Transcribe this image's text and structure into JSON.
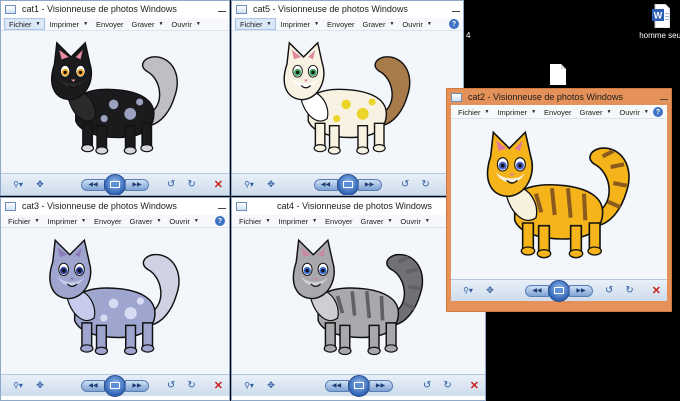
{
  "desktop": {
    "icons": [
      {
        "id": "word",
        "label": "homme seul",
        "icon": "word-document-icon"
      },
      {
        "id": "file",
        "label": "",
        "icon": "blank-file-icon"
      }
    ],
    "stray_label": "4"
  },
  "menu": {
    "items": [
      "Fichier",
      "Imprimer",
      "Envoyer",
      "Graver",
      "Ouvrir"
    ],
    "help": "?"
  },
  "windows": [
    {
      "id": "cat1",
      "title": "cat1 - Visionneuse de photos Windows",
      "active": false,
      "cat": {
        "body": "#1b1b1d",
        "belly": "#2a2a2c",
        "tail": "#bfbfc3",
        "patch": "#6a6c78",
        "spots": "#9aa2c0",
        "eye": "#f0a21e",
        "nose": "#ea8ba0",
        "socks": "#d8d8dc"
      }
    },
    {
      "id": "cat5",
      "title": "cat5 - Visionneuse de photos Windows",
      "active": false,
      "cat": {
        "body": "#f7f2e2",
        "belly": "#ffffff",
        "tail": "#a87b4a",
        "patch": "#8b5a2b",
        "spots": "#ecd52a",
        "eye": "#38a85a",
        "nose": "#e08aa0",
        "socks": "#f7f2e2"
      }
    },
    {
      "id": "cat2",
      "title": "cat2 - Visionneuse de photos Windows",
      "active": true,
      "cat": {
        "body": "#f4b41a",
        "belly": "#f7f0dd",
        "tail": "#f4b41a",
        "patch": "#8a5a1e",
        "spots": "#8a5a1e",
        "eye": "#4560c8",
        "nose": "#e07a9a",
        "socks": "#f4b41a"
      }
    },
    {
      "id": "cat3",
      "title": "cat3 - Visionneuse de photos Windows",
      "active": false,
      "cat": {
        "body": "#9ea6cf",
        "belly": "#c7ccec",
        "tail": "#d0d2e4",
        "patch": "#8790ba",
        "spots": "#d7dbf3",
        "eye": "#2d3c9a",
        "nose": "#8c7fb8",
        "socks": "#9ea6cf"
      }
    },
    {
      "id": "cat4",
      "title": "cat4 - Visionneuse de photos Windows",
      "active": false,
      "cat": {
        "body": "#a9a9ad",
        "belly": "#cfcfd3",
        "tail": "#707075",
        "patch": "#606065",
        "spots": "#6a6a70",
        "eye": "#3a6ad0",
        "nose": "#c98aa0",
        "socks": "#a9a9ad"
      }
    }
  ]
}
